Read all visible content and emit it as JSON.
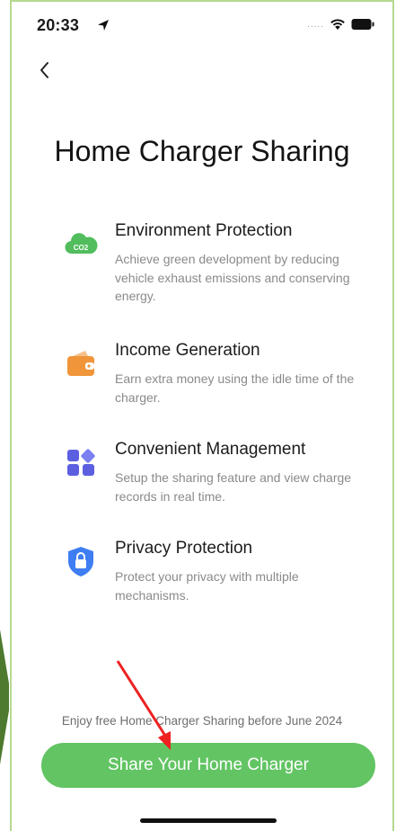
{
  "status_bar": {
    "time": "20:33",
    "signal_dots": "....."
  },
  "header": {
    "back_label": "<"
  },
  "page": {
    "title": "Home Charger Sharing"
  },
  "features": [
    {
      "icon": "co2-cloud-icon",
      "icon_text": "CO2",
      "title": "Environment Protection",
      "desc": "Achieve green development by reducing vehicle exhaust emissions and conserving energy."
    },
    {
      "icon": "wallet-icon",
      "title": "Income Generation",
      "desc": "Earn extra money using the idle time of the charger."
    },
    {
      "icon": "grid-apps-icon",
      "title": "Convenient Management",
      "desc": "Setup the sharing feature and view charge records in real time."
    },
    {
      "icon": "shield-lock-icon",
      "title": "Privacy Protection",
      "desc": "Protect your privacy with multiple mechanisms."
    }
  ],
  "footer": {
    "promo": "Enjoy free Home Charger Sharing before June 2024",
    "cta_label": "Share Your Home Charger"
  },
  "colors": {
    "accent_green": "#62c463",
    "wallet_orange": "#f0953a",
    "grid_purple": "#5b5fe0",
    "shield_blue": "#3f7ef2",
    "annotation_red": "#ee2020"
  }
}
